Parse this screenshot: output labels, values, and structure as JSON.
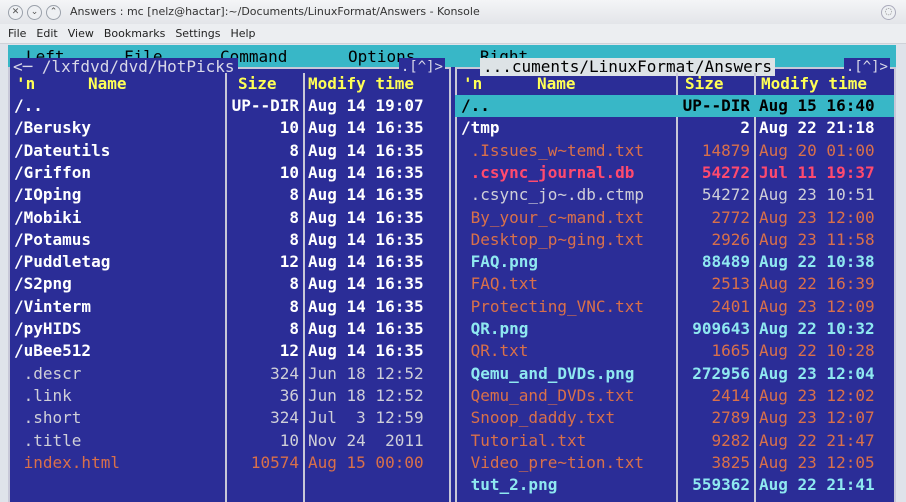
{
  "window": {
    "title": "Answers : mc [nelz@hactar]:~/Documents/LinuxFormat/Answers - Konsole"
  },
  "menubar": [
    "File",
    "Edit",
    "View",
    "Bookmarks",
    "Settings",
    "Help"
  ],
  "mc_menu": [
    "Left",
    "File",
    "Command",
    "Options",
    "Right"
  ],
  "left_panel": {
    "path": "<─ /lxfdvd/dvd/HotPicks",
    "corner": ".[^]>",
    "headers": {
      "n": "'n",
      "name": "Name",
      "size": "Size",
      "modify": "Modify time"
    },
    "rows": [
      {
        "name": "/..",
        "size": "UP--DIR",
        "date": "Aug 14 19:07",
        "kind": "dir"
      },
      {
        "name": "/Berusky",
        "size": "10",
        "date": "Aug 14 16:35",
        "kind": "dir"
      },
      {
        "name": "/Dateutils",
        "size": "8",
        "date": "Aug 14 16:35",
        "kind": "dir"
      },
      {
        "name": "/Griffon",
        "size": "10",
        "date": "Aug 14 16:35",
        "kind": "dir"
      },
      {
        "name": "/IOping",
        "size": "8",
        "date": "Aug 14 16:35",
        "kind": "dir"
      },
      {
        "name": "/Mobiki",
        "size": "8",
        "date": "Aug 14 16:35",
        "kind": "dir"
      },
      {
        "name": "/Potamus",
        "size": "8",
        "date": "Aug 14 16:35",
        "kind": "dir"
      },
      {
        "name": "/Puddletag",
        "size": "12",
        "date": "Aug 14 16:35",
        "kind": "dir"
      },
      {
        "name": "/S2png",
        "size": "8",
        "date": "Aug 14 16:35",
        "kind": "dir"
      },
      {
        "name": "/Vinterm",
        "size": "8",
        "date": "Aug 14 16:35",
        "kind": "dir"
      },
      {
        "name": "/pyHIDS",
        "size": "8",
        "date": "Aug 14 16:35",
        "kind": "dir"
      },
      {
        "name": "/uBee512",
        "size": "12",
        "date": "Aug 14 16:35",
        "kind": "dir"
      },
      {
        "name": " .descr",
        "size": "324",
        "date": "Jun 18 12:52",
        "kind": "dot"
      },
      {
        "name": " .link",
        "size": "36",
        "date": "Jun 18 12:52",
        "kind": "dot"
      },
      {
        "name": " .short",
        "size": "324",
        "date": "Jul  3 12:59",
        "kind": "dot"
      },
      {
        "name": " .title",
        "size": "10",
        "date": "Nov 24  2011",
        "kind": "dot"
      },
      {
        "name": " index.html",
        "size": "10574",
        "date": "Aug 15 00:00",
        "kind": "orange"
      }
    ]
  },
  "right_panel": {
    "path": "...cuments/LinuxFormat/Answers",
    "corner": ".[^]>",
    "headers": {
      "n": "'n",
      "name": "Name",
      "size": "Size",
      "modify": "Modify time"
    },
    "rows": [
      {
        "name": "/..",
        "size": "UP--DIR",
        "date": "Aug 15 16:40",
        "kind": "sel"
      },
      {
        "name": "/tmp",
        "size": "2",
        "date": "Aug 22 21:18",
        "kind": "dir"
      },
      {
        "name": " .Issues_w~temd.txt",
        "size": "14879",
        "date": "Aug 20 01:00",
        "kind": "orange"
      },
      {
        "name": " .csync_journal.db",
        "size": "54272",
        "date": "Jul 11 19:37",
        "kind": "red"
      },
      {
        "name": " .csync_jo~.db.ctmp",
        "size": "54272",
        "date": "Aug 23 10:51",
        "kind": "dot"
      },
      {
        "name": " By_your_c~mand.txt",
        "size": "2772",
        "date": "Aug 23 12:00",
        "kind": "orange"
      },
      {
        "name": " Desktop_p~ging.txt",
        "size": "2926",
        "date": "Aug 23 11:58",
        "kind": "orange"
      },
      {
        "name": " FAQ.png",
        "size": "88489",
        "date": "Aug 22 10:38",
        "kind": "img"
      },
      {
        "name": " FAQ.txt",
        "size": "2513",
        "date": "Aug 22 16:39",
        "kind": "orange"
      },
      {
        "name": " Protecting_VNC.txt",
        "size": "2401",
        "date": "Aug 23 12:09",
        "kind": "orange"
      },
      {
        "name": " QR.png",
        "size": "909643",
        "date": "Aug 22 10:32",
        "kind": "img"
      },
      {
        "name": " QR.txt",
        "size": "1665",
        "date": "Aug 22 10:28",
        "kind": "orange"
      },
      {
        "name": " Qemu_and_DVDs.png",
        "size": "272956",
        "date": "Aug 23 12:04",
        "kind": "img"
      },
      {
        "name": " Qemu_and_DVDs.txt",
        "size": "2414",
        "date": "Aug 23 12:02",
        "kind": "orange"
      },
      {
        "name": " Snoop_daddy.txt",
        "size": "2789",
        "date": "Aug 23 12:07",
        "kind": "orange"
      },
      {
        "name": " Tutorial.txt",
        "size": "9282",
        "date": "Aug 22 21:47",
        "kind": "orange"
      },
      {
        "name": " Video_pre~tion.txt",
        "size": "3825",
        "date": "Aug 23 12:05",
        "kind": "orange"
      },
      {
        "name": " tut_2.png",
        "size": "559362",
        "date": "Aug 22 21:41",
        "kind": "img"
      }
    ]
  }
}
